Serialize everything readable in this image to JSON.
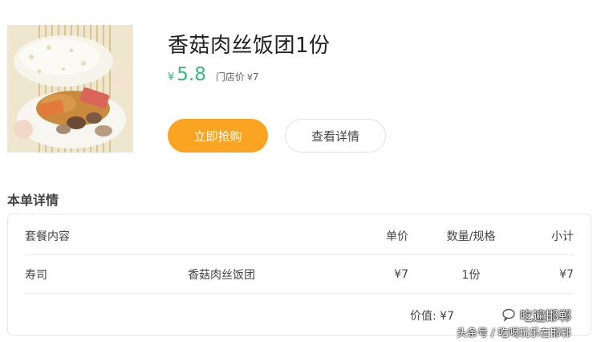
{
  "product": {
    "title": "香菇肉丝饭团1份",
    "price_symbol": "¥",
    "price": "5.8",
    "store_price_label": "门店价",
    "store_price_symbol": "¥",
    "store_price": "7"
  },
  "actions": {
    "buy_label": "立即抢购",
    "detail_label": "查看详情"
  },
  "order": {
    "section_title": "本单详情",
    "headers": [
      "套餐内容",
      "单价",
      "数量/规格",
      "小计"
    ],
    "items": [
      {
        "category": "寿司",
        "name": "香菇肉丝饭团",
        "unit_price": "¥7",
        "quantity": "1份",
        "subtotal": "¥7"
      }
    ],
    "value_label": "价值:",
    "value": "¥7"
  },
  "watermark": {
    "line1": "吃遍邯郸",
    "line2": "头条号 / 吃喝玩乐在邯郸"
  },
  "colors": {
    "accent_green": "#3ab77e",
    "button_orange": "#fba423"
  }
}
